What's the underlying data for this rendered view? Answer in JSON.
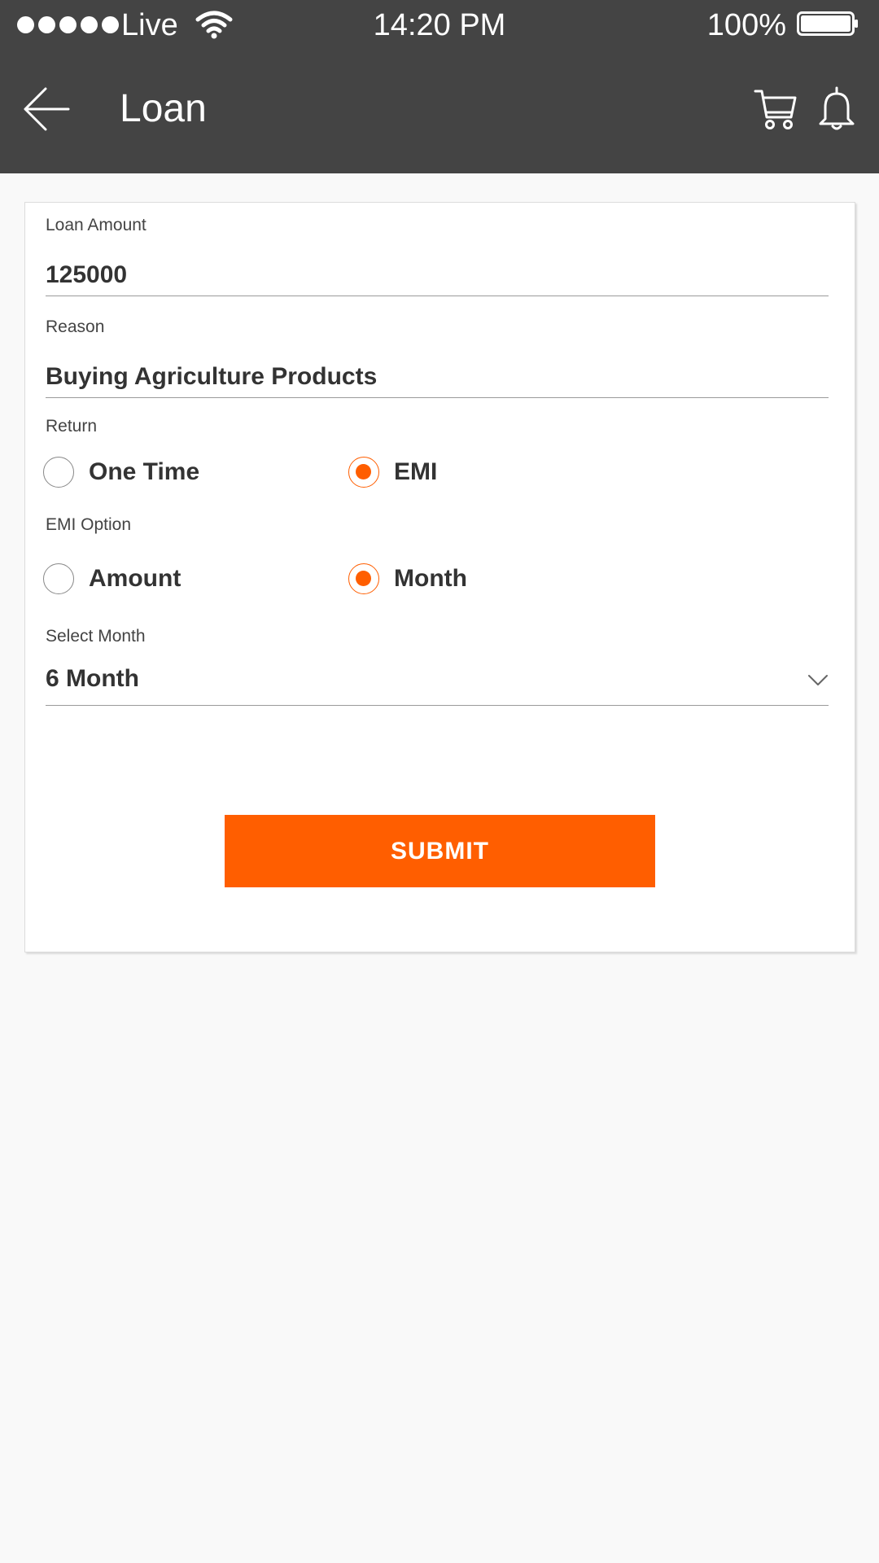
{
  "status_bar": {
    "carrier": "Live",
    "time": "14:20 PM",
    "battery": "100%"
  },
  "header": {
    "title": "Loan",
    "back_icon": "arrow-left-icon",
    "cart_icon": "cart-icon",
    "notification_icon": "bell-icon"
  },
  "form": {
    "loan_amount": {
      "label": "Loan Amount",
      "value": "125000"
    },
    "reason": {
      "label": "Reason",
      "value": "Buying Agriculture Products"
    },
    "return": {
      "label": "Return",
      "options": [
        {
          "label": "One Time",
          "selected": false
        },
        {
          "label": "EMI",
          "selected": true
        }
      ]
    },
    "emi_option": {
      "label": "EMI Option",
      "options": [
        {
          "label": "Amount",
          "selected": false
        },
        {
          "label": "Month",
          "selected": true
        }
      ]
    },
    "select_month": {
      "label": "Select Month",
      "value": "6 Month"
    },
    "submit_label": "SUBMIT"
  },
  "colors": {
    "header_bg": "#444444",
    "accent": "#ff5e00",
    "page_bg": "#f9f9f9"
  }
}
